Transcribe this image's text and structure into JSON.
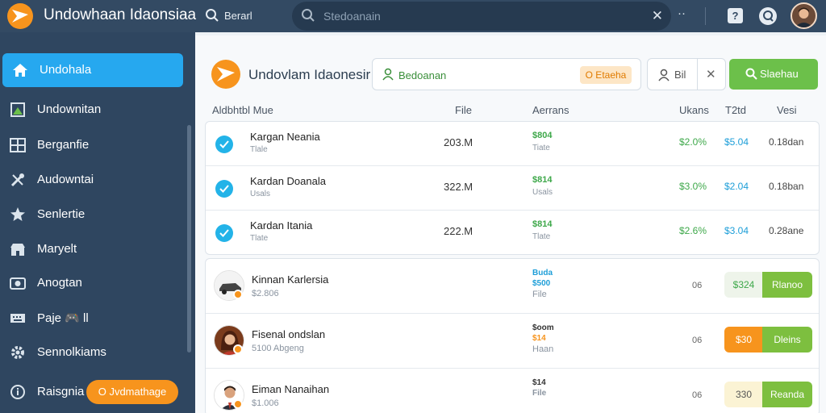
{
  "colors": {
    "topbar": "#334a63",
    "sidebar": "#2f4660",
    "active": "#26a8ef",
    "accent": "#f7941d",
    "success": "#6cc04a"
  },
  "topbar": {
    "title": "Undowhaan Idaonsiaa",
    "search_label": "Berarl",
    "search_placeholder": "Stedoanain",
    "more": "··",
    "help": "?",
    "icons": [
      "logo-icon",
      "search-icon",
      "clear-icon",
      "help-icon",
      "chat-icon",
      "avatar"
    ]
  },
  "sidebar": {
    "items": [
      {
        "label": "Undohala",
        "icon": "home-icon",
        "active": true
      },
      {
        "label": "Undownitan",
        "icon": "flag-icon"
      },
      {
        "label": "Berganfie",
        "icon": "grid-icon"
      },
      {
        "label": "Audowntai",
        "icon": "tools-icon"
      },
      {
        "label": "Senlertie",
        "icon": "star-icon"
      },
      {
        "label": "Maryelt",
        "icon": "store-icon"
      },
      {
        "label": "Anogtan",
        "icon": "camera-icon"
      },
      {
        "label": "Paje 🎮 ll",
        "icon": "keyboard-icon"
      },
      {
        "label": "Sennolkiams",
        "icon": "gear-icon"
      },
      {
        "label": "Raisgnia",
        "icon": "info-icon"
      }
    ],
    "cta": "O Jvdmathage"
  },
  "main": {
    "title": "Undovlam Idaonesir",
    "filter_text": "Bedoanan",
    "filter_tag": "O Etaeha",
    "filter2_text": "Bil",
    "primary_button": "Slaehau",
    "columns": [
      "Aldbhtbl Mue",
      "File",
      "Aerrans",
      "Ukans",
      "T2td",
      "Vesi"
    ]
  },
  "table_a": [
    {
      "name": "Kargan Neania",
      "sub": "Tlale",
      "size": "203.M",
      "amount": "$804",
      "amount_sub": "Tiate",
      "pct": "$2.0%",
      "price": "$5.04",
      "version": "0.18dan"
    },
    {
      "name": "Kardan Doanala",
      "sub": "Usals",
      "size": "322.M",
      "amount": "$814",
      "amount_sub": "Usals",
      "pct": "$3.0%",
      "price": "$2.04",
      "version": "0.18ban"
    },
    {
      "name": "Kardan Itania",
      "sub": "Tlate",
      "size": "222.M",
      "amount": "$814",
      "amount_sub": "Tlate",
      "pct": "$2.6%",
      "price": "$3.04",
      "version": "0.28ane"
    }
  ],
  "table_b": [
    {
      "name": "Kinnan Karlersia",
      "sub": "$2.806",
      "line1": "Buda",
      "line1_color": "#1d9ed8",
      "line2": "$500",
      "line2_color": "#1d9ed8",
      "line3": "File",
      "qty": "06",
      "pill": "$324",
      "pill_bg": "#eef4ea",
      "pill_color": "#3ea84a",
      "action": "Rlanoo",
      "avatar": "car"
    },
    {
      "name": "Fisenal ondslan",
      "sub": "5100  Abgeng",
      "line1": "$oom",
      "line1_color": "#333333",
      "line2": "$14",
      "line2_color": "#f7941d",
      "line3": "Haan",
      "qty": "06",
      "pill": "$30",
      "pill_bg": "#f7941d",
      "pill_color": "#ffffff",
      "action": "Dleins",
      "avatar": "woman"
    },
    {
      "name": "Eiman Nanaihan",
      "sub": "$1.006",
      "line1": "$14",
      "line1_color": "#333333",
      "line2": "File",
      "line2_color": "#8a94a0",
      "line3": "",
      "qty": "06",
      "pill": "330",
      "pill_bg": "#fbf3d4",
      "pill_color": "#555555",
      "action": "Reanda",
      "avatar": "man"
    }
  ]
}
